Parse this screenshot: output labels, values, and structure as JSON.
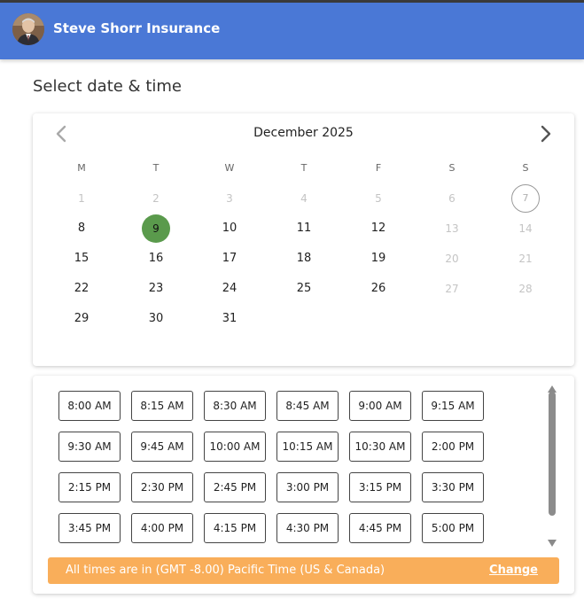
{
  "header": {
    "title": "Steve Shorr Insurance",
    "avatar_icon": "person-photo-icon",
    "bg_color": "#4a78d6"
  },
  "page": {
    "heading": "Select date & time"
  },
  "calendar": {
    "month_label": "December 2025",
    "prev_icon": "chevron-left-icon",
    "next_icon": "chevron-right-icon",
    "weekdays": [
      "M",
      "T",
      "W",
      "T",
      "F",
      "S",
      "S"
    ],
    "weeks": [
      [
        {
          "label": "1",
          "state": "disabled"
        },
        {
          "label": "2",
          "state": "disabled"
        },
        {
          "label": "3",
          "state": "disabled"
        },
        {
          "label": "4",
          "state": "disabled"
        },
        {
          "label": "5",
          "state": "disabled"
        },
        {
          "label": "6",
          "state": "disabled"
        },
        {
          "label": "7",
          "state": "today"
        }
      ],
      [
        {
          "label": "8",
          "state": "available"
        },
        {
          "label": "9",
          "state": "selected"
        },
        {
          "label": "10",
          "state": "available"
        },
        {
          "label": "11",
          "state": "available"
        },
        {
          "label": "12",
          "state": "available"
        },
        {
          "label": "13",
          "state": "disabled"
        },
        {
          "label": "14",
          "state": "disabled"
        }
      ],
      [
        {
          "label": "15",
          "state": "available"
        },
        {
          "label": "16",
          "state": "available"
        },
        {
          "label": "17",
          "state": "available"
        },
        {
          "label": "18",
          "state": "available"
        },
        {
          "label": "19",
          "state": "available"
        },
        {
          "label": "20",
          "state": "disabled"
        },
        {
          "label": "21",
          "state": "disabled"
        }
      ],
      [
        {
          "label": "22",
          "state": "available"
        },
        {
          "label": "23",
          "state": "available"
        },
        {
          "label": "24",
          "state": "available"
        },
        {
          "label": "25",
          "state": "available"
        },
        {
          "label": "26",
          "state": "available"
        },
        {
          "label": "27",
          "state": "disabled"
        },
        {
          "label": "28",
          "state": "disabled"
        }
      ],
      [
        {
          "label": "29",
          "state": "available"
        },
        {
          "label": "30",
          "state": "available"
        },
        {
          "label": "31",
          "state": "available"
        }
      ]
    ],
    "selected_color": "#5a9a4c"
  },
  "times": {
    "slots": [
      "8:00 AM",
      "8:15 AM",
      "8:30 AM",
      "8:45 AM",
      "9:00 AM",
      "9:15 AM",
      "9:30 AM",
      "9:45 AM",
      "10:00 AM",
      "10:15 AM",
      "10:30 AM",
      "2:00 PM",
      "2:15 PM",
      "2:30 PM",
      "2:45 PM",
      "3:00 PM",
      "3:15 PM",
      "3:30 PM",
      "3:45 PM",
      "4:00 PM",
      "4:15 PM",
      "4:30 PM",
      "4:45 PM",
      "5:00 PM"
    ],
    "scroll_up_icon": "triangle-up-icon",
    "scroll_down_icon": "triangle-down-icon"
  },
  "timezone": {
    "text": "All times are in (GMT -8.00) Pacific Time (US & Canada)",
    "change_label": "Change",
    "bar_color": "#f9ae5a"
  }
}
